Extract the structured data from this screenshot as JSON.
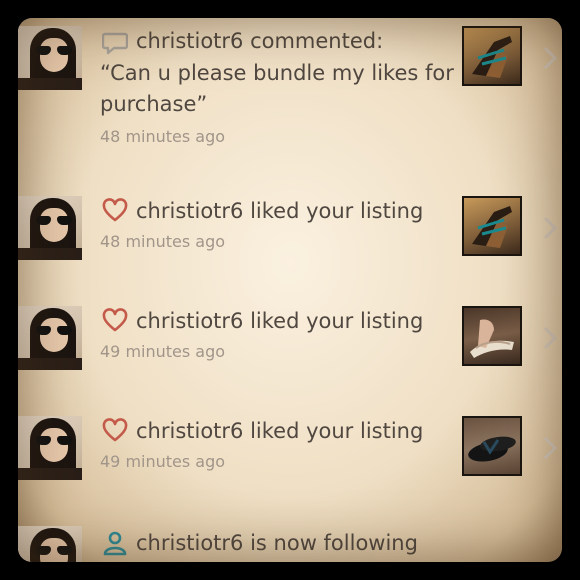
{
  "notifications": [
    {
      "type": "comment",
      "icon": "speech-bubble-icon",
      "user": "christiotr6",
      "action_text": "christiotr6 commented:",
      "quote": "“Can u please bundle my likes for purchase”",
      "time": "48 minutes ago",
      "thumb": "sandal-wedge-black"
    },
    {
      "type": "like",
      "icon": "heart-icon",
      "user": "christiotr6",
      "action_text": "christiotr6 liked your listing",
      "time": "48 minutes ago",
      "thumb": "sandal-wedge-black"
    },
    {
      "type": "like",
      "icon": "heart-icon",
      "user": "christiotr6",
      "action_text": "christiotr6 liked your listing",
      "time": "49 minutes ago",
      "thumb": "sandal-wedge-cream"
    },
    {
      "type": "like",
      "icon": "heart-icon",
      "user": "christiotr6",
      "action_text": "christiotr6 liked your listing",
      "time": "49 minutes ago",
      "thumb": "flip-flops"
    },
    {
      "type": "follow",
      "icon": "person-icon",
      "user": "christiotr6",
      "action_text": "christiotr6 is now following"
    }
  ],
  "colors": {
    "text": "#4f4740",
    "time": "#a1958a",
    "heart": "#c45a4a",
    "comment_icon": "#a8a29a",
    "follow_icon": "#2e8a96"
  }
}
